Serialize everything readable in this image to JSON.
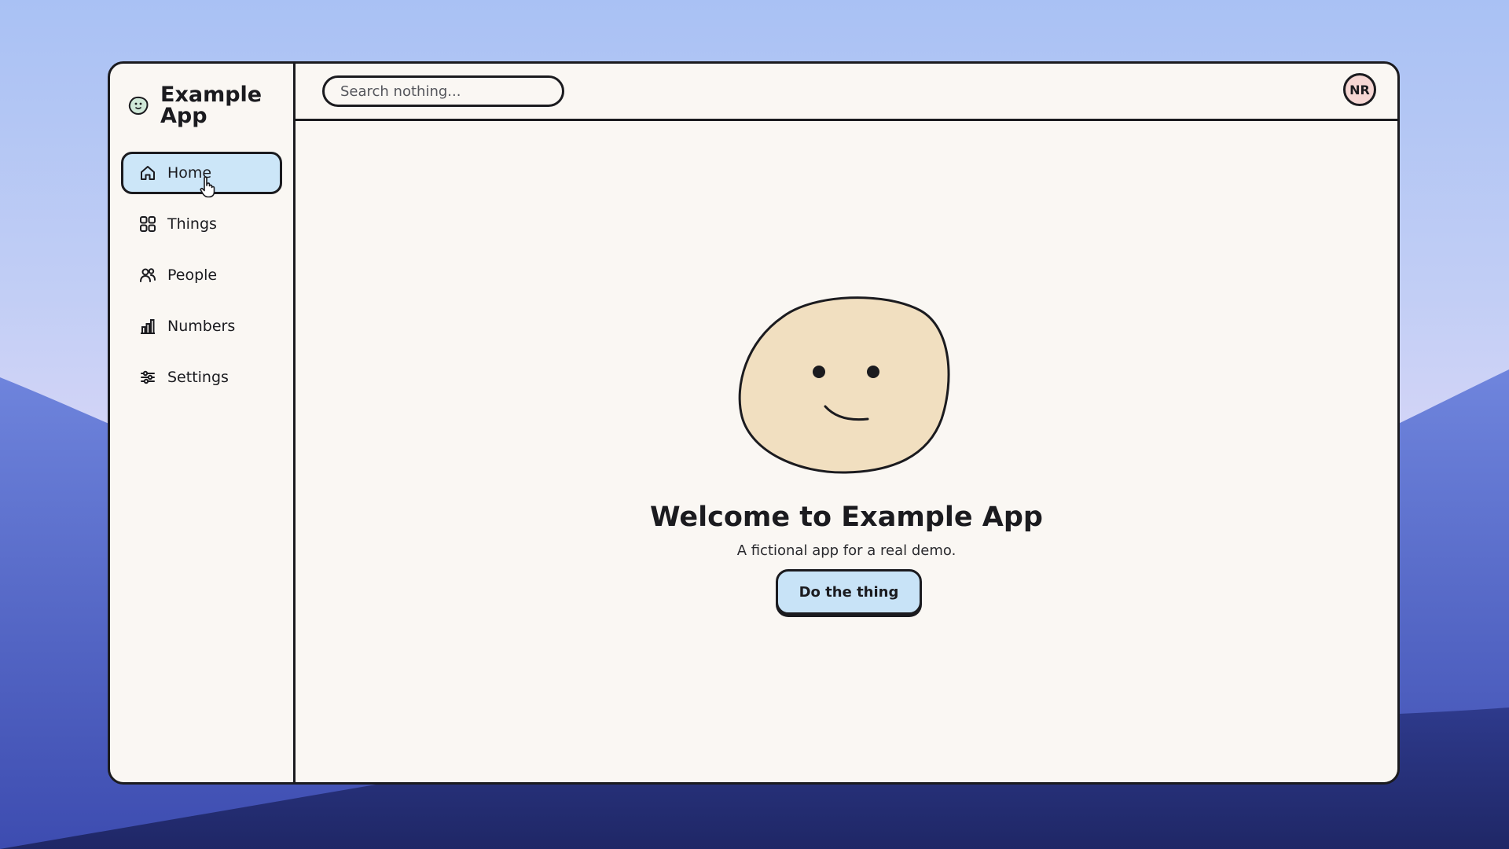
{
  "app": {
    "name": "Example App",
    "logo_icon": "smiley-blob-icon"
  },
  "sidebar": {
    "items": [
      {
        "label": "Home",
        "icon": "home-icon",
        "active": true
      },
      {
        "label": "Things",
        "icon": "grid-icon",
        "active": false
      },
      {
        "label": "People",
        "icon": "people-icon",
        "active": false
      },
      {
        "label": "Numbers",
        "icon": "bar-chart-icon",
        "active": false
      },
      {
        "label": "Settings",
        "icon": "sliders-icon",
        "active": false
      }
    ]
  },
  "header": {
    "search": {
      "placeholder": "Search nothing...",
      "value": ""
    },
    "avatar": {
      "initials": "NR"
    }
  },
  "main": {
    "illustration": "smiling-blob",
    "title": "Welcome to Example App",
    "subtitle": "A fictional app for a real demo.",
    "cta_label": "Do the thing"
  },
  "colors": {
    "accent": "#cce6f8",
    "ink": "#1b1b1f",
    "surface": "#faf7f3",
    "blob_fill": "#f1dfc0",
    "avatar_bg": "#f5d6d3"
  }
}
